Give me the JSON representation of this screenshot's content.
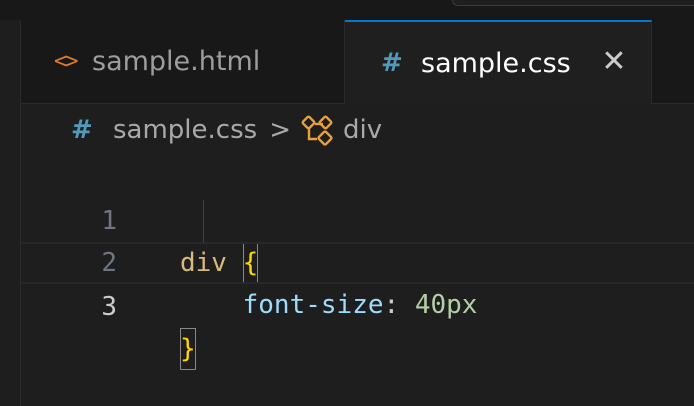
{
  "tabs": [
    {
      "icon": "html-brackets-icon",
      "icon_glyph": "<>",
      "label": "sample.html",
      "active": false
    },
    {
      "icon": "css-hash-icon",
      "icon_glyph": "#",
      "label": "sample.css",
      "active": true,
      "close_glyph": "✕"
    }
  ],
  "breadcrumb": {
    "file_icon_glyph": "#",
    "file": "sample.css",
    "separator": ">",
    "symbol": "div"
  },
  "editor": {
    "lines": [
      {
        "number": "1",
        "selector": "div",
        "space": " ",
        "brace": "{"
      },
      {
        "number": "2",
        "indent": "    ",
        "property": "font-size",
        "colon": ":",
        "space": " ",
        "value": "40px"
      },
      {
        "number": "3",
        "brace": "}"
      }
    ]
  },
  "colors": {
    "accent": "#0078d4",
    "editor_bg": "#1e1e1e",
    "tabbar_bg": "#181818",
    "selector": "#d7ba7d",
    "brace": "#ffd700",
    "property": "#9cdcfe",
    "number": "#b5cea8",
    "html_icon": "#e37933",
    "css_icon": "#519aba"
  }
}
